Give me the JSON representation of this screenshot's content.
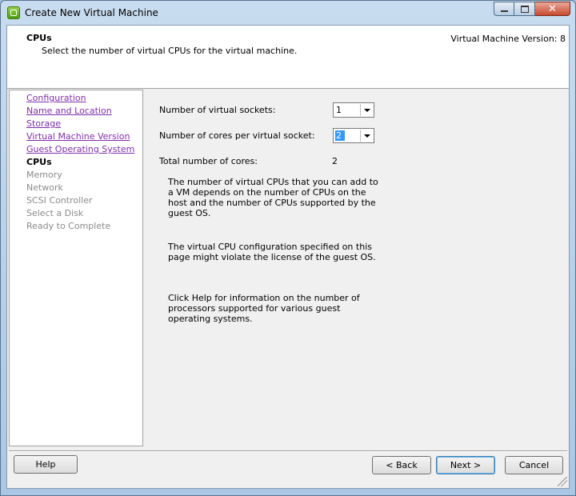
{
  "window": {
    "title": "Create New Virtual Machine"
  },
  "header": {
    "title": "CPUs",
    "subtitle": "Select the number of virtual CPUs for the virtual machine.",
    "version": "Virtual Machine Version: 8"
  },
  "nav": {
    "items": [
      {
        "label": "Configuration",
        "state": "link"
      },
      {
        "label": "Name and Location",
        "state": "link"
      },
      {
        "label": "Storage",
        "state": "link"
      },
      {
        "label": "Virtual Machine Version",
        "state": "link"
      },
      {
        "label": "Guest Operating System",
        "state": "link"
      },
      {
        "label": "CPUs",
        "state": "current"
      },
      {
        "label": "Memory",
        "state": "disabled"
      },
      {
        "label": "Network",
        "state": "disabled"
      },
      {
        "label": "SCSI Controller",
        "state": "disabled"
      },
      {
        "label": "Select a Disk",
        "state": "disabled"
      },
      {
        "label": "Ready to Complete",
        "state": "disabled"
      }
    ]
  },
  "form": {
    "sockets_label": "Number of virtual sockets:",
    "sockets_value": "1",
    "cores_label": "Number of cores per virtual socket:",
    "cores_value": "2",
    "total_label": "Total number of cores:",
    "total_value": "2",
    "info_1": "The number of virtual CPUs that you can add to a VM depends on the number of CPUs on the host and the number of CPUs supported by the guest OS.",
    "info_2": "The virtual CPU configuration specified on this page might violate the license of the guest OS.",
    "info_3": "Click Help for information on the number of processors supported for various guest operating systems."
  },
  "buttons": {
    "help": "Help",
    "back": "< Back",
    "next": "Next >",
    "cancel": "Cancel"
  },
  "colors": {
    "link": "#7e2ea8",
    "disabled": "#8a8a8a",
    "selection": "#3399ff"
  }
}
